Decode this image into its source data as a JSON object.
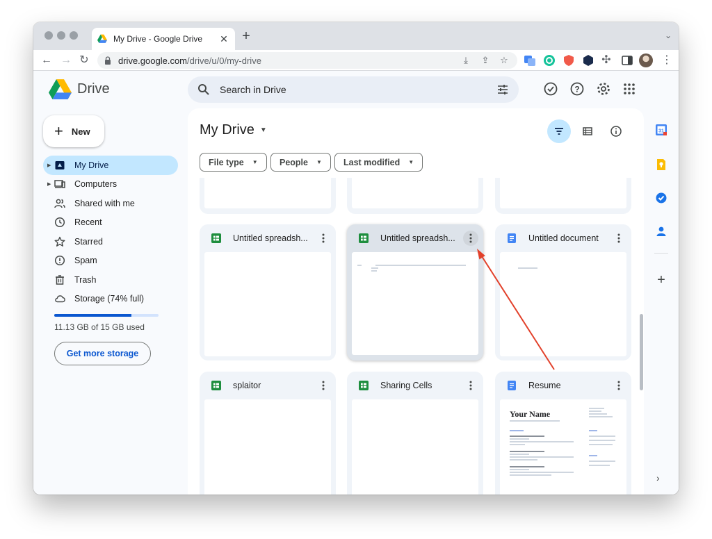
{
  "browser": {
    "tab_title": "My Drive - Google Drive",
    "url_host": "drive.google.com",
    "url_path": "/drive/u/0/my-drive"
  },
  "app": {
    "name": "Drive",
    "search_placeholder": "Search in Drive"
  },
  "sidebar": {
    "new_label": "New",
    "items": [
      {
        "label": "My Drive",
        "icon": "my-drive-icon",
        "active": true,
        "expandable": true
      },
      {
        "label": "Computers",
        "icon": "computers-icon",
        "active": false,
        "expandable": true
      },
      {
        "label": "Shared with me",
        "icon": "shared-icon",
        "active": false,
        "expandable": false
      },
      {
        "label": "Recent",
        "icon": "clock-icon",
        "active": false,
        "expandable": false
      },
      {
        "label": "Starred",
        "icon": "star-icon",
        "active": false,
        "expandable": false
      },
      {
        "label": "Spam",
        "icon": "spam-icon",
        "active": false,
        "expandable": false
      },
      {
        "label": "Trash",
        "icon": "trash-icon",
        "active": false,
        "expandable": false
      },
      {
        "label": "Storage (74% full)",
        "icon": "cloud-icon",
        "active": false,
        "expandable": false
      }
    ],
    "storage_fraction": 0.74,
    "storage_used_text": "11.13 GB of 15 GB used",
    "get_storage_label": "Get more storage"
  },
  "main": {
    "title": "My Drive",
    "filters": [
      "File type",
      "People",
      "Last modified"
    ],
    "files": [
      {
        "name": "Untitled spreadsheet",
        "display": "Untitled spreadsh...",
        "type": "sheets"
      },
      {
        "name": "Untitled spreadsheet",
        "display": "Untitled spreadsh...",
        "type": "sheets",
        "selected": true
      },
      {
        "name": "Untitled document",
        "display": "Untitled document",
        "type": "docs"
      },
      {
        "name": "splaitor",
        "display": "splaitor",
        "type": "sheets"
      },
      {
        "name": "Sharing Cells",
        "display": "Sharing Cells",
        "type": "sheets"
      },
      {
        "name": "Resume",
        "display": "Resume",
        "type": "docs"
      }
    ],
    "resume_preview_heading": "Your Name"
  },
  "colors": {
    "accent": "#0b57d0",
    "active_nav": "#c2e7ff",
    "sheets_green": "#1e8e3e",
    "docs_blue": "#4285f4",
    "annotation_arrow": "#e2412b"
  }
}
